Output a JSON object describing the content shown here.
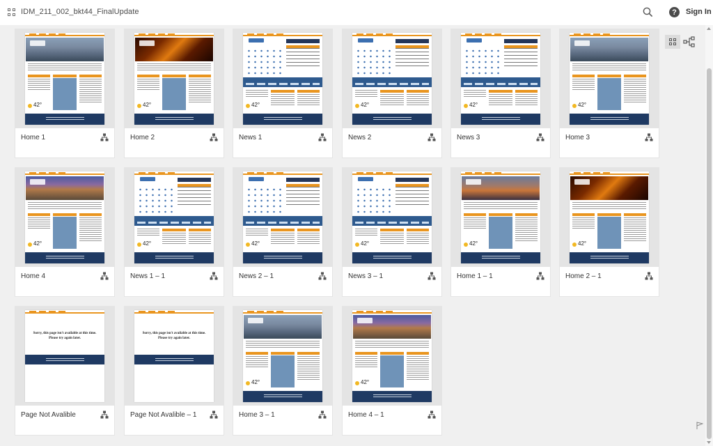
{
  "header": {
    "title": "IDM_211_002_bkt44_FinalUpdate",
    "signin_label": "Sign In",
    "help_glyph": "?"
  },
  "colors": {
    "accent_orange": "#e9951f",
    "navy": "#1f3a63",
    "light_blue": "#6f93b8"
  },
  "artboards": [
    {
      "label": "Home 1",
      "kind": "home",
      "hero": "aerial"
    },
    {
      "label": "Home 2",
      "kind": "home",
      "hero": "fire"
    },
    {
      "label": "News 1",
      "kind": "news"
    },
    {
      "label": "News 2",
      "kind": "news"
    },
    {
      "label": "News 3",
      "kind": "news"
    },
    {
      "label": "Home 3",
      "kind": "home",
      "hero": "aerial"
    },
    {
      "label": "Home 4",
      "kind": "home",
      "hero": "build"
    },
    {
      "label": "News 1 – 1",
      "kind": "news"
    },
    {
      "label": "News 2 – 1",
      "kind": "news"
    },
    {
      "label": "News 3 – 1",
      "kind": "news"
    },
    {
      "label": "Home 1 – 1",
      "kind": "home",
      "hero": "city"
    },
    {
      "label": "Home 2 – 1",
      "kind": "home",
      "hero": "fire"
    },
    {
      "label": "Page Not Avalible",
      "kind": "error"
    },
    {
      "label": "Page Not Avalible – 1",
      "kind": "error"
    },
    {
      "label": "Home 3 – 1",
      "kind": "home",
      "hero": "aerial"
    },
    {
      "label": "Home 4 – 1",
      "kind": "home",
      "hero": "build"
    }
  ],
  "thumbnail_text": {
    "temperature": "42°",
    "error_message_line1": "Sorry, this page isn't available at this time.",
    "error_message_line2": "Please try again later."
  },
  "icons": {
    "apps": "grid-icon",
    "search": "search-icon",
    "help": "help-icon",
    "flow": "flow-icon",
    "grid_view": "grid-view-icon",
    "flow_view": "flow-view-icon"
  }
}
